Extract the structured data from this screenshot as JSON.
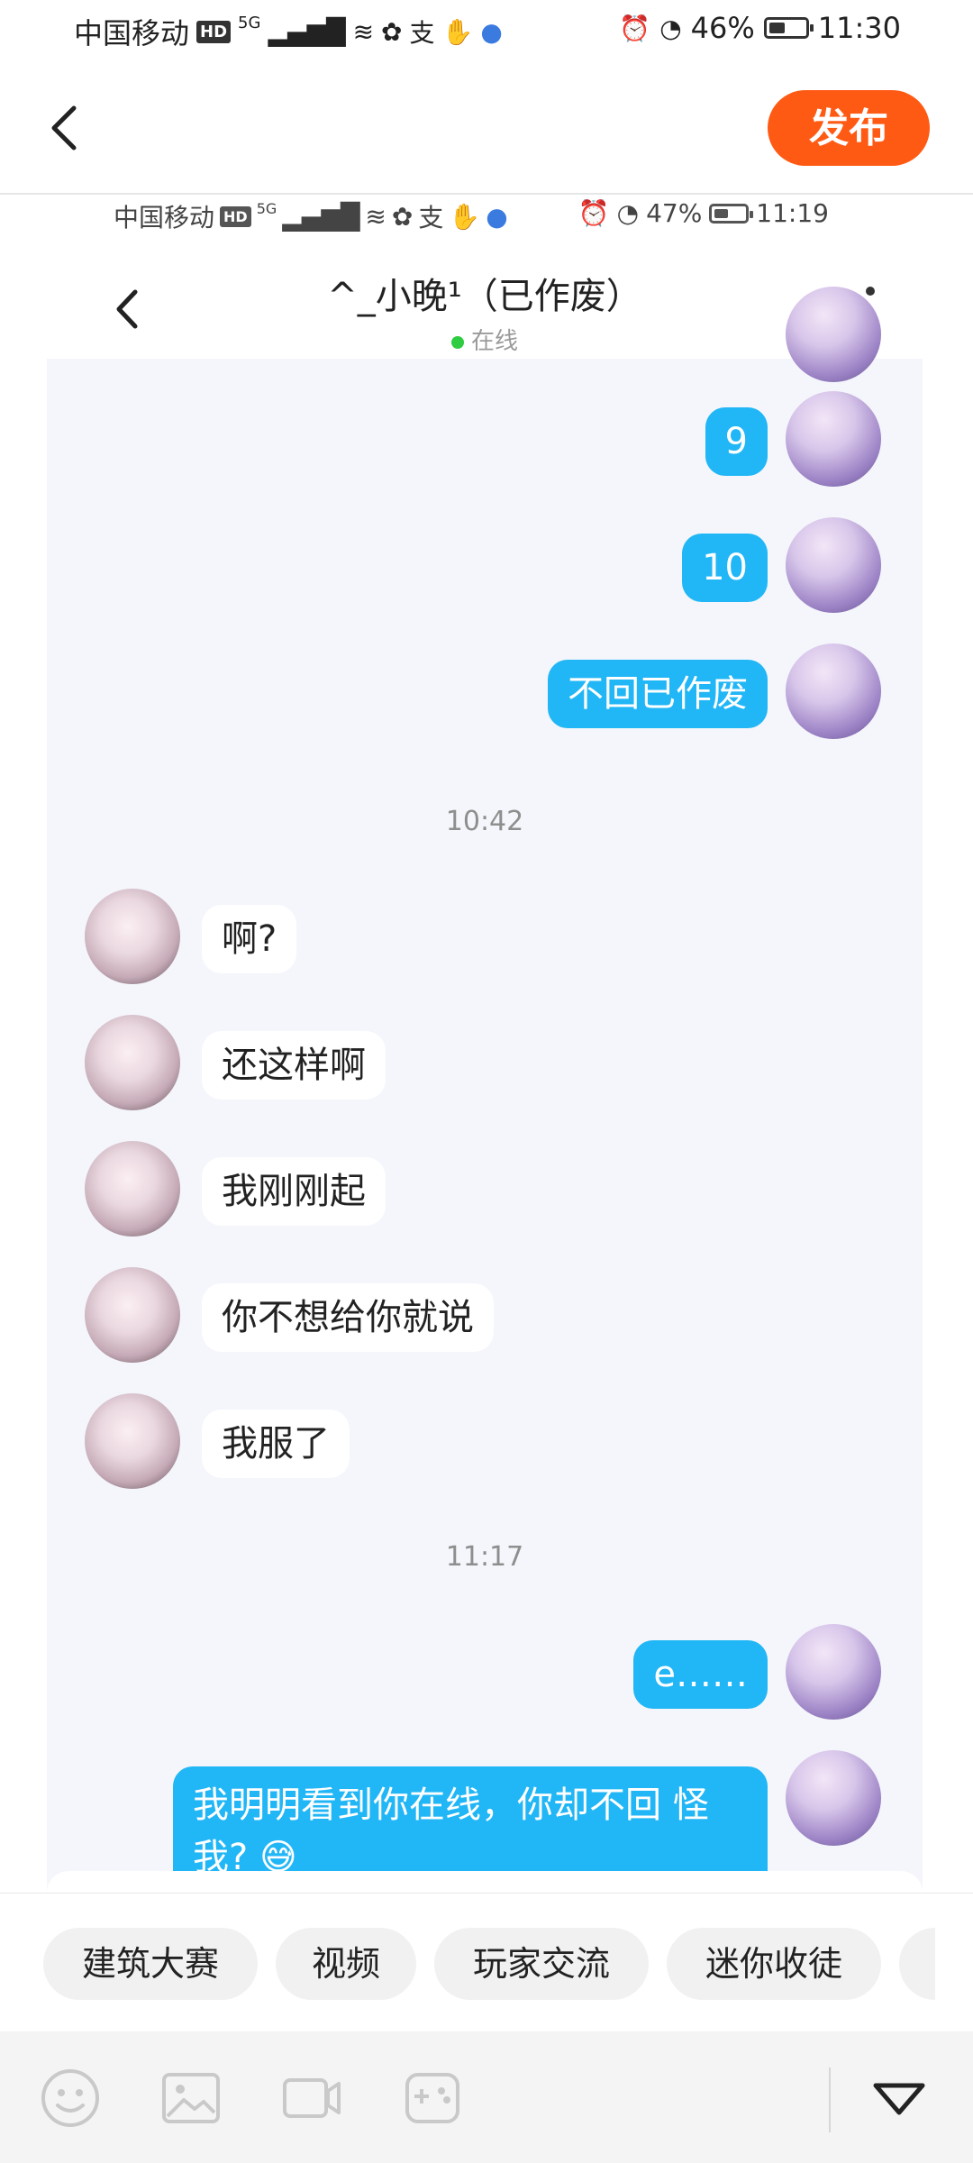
{
  "status_bar": {
    "carrier": "中国移动",
    "hd": "HD",
    "signal": "5G",
    "battery": "46%",
    "battery_level": 0.46,
    "time": "11:30"
  },
  "top_bar": {
    "publish_label": "发布"
  },
  "screenshot": {
    "status_bar": {
      "carrier": "中国移动",
      "hd": "HD",
      "signal": "5G",
      "battery": "47%",
      "battery_level": 0.47,
      "time": "11:19"
    },
    "chat": {
      "title": "^_小晚¹（已作废）",
      "presence": "在线",
      "messages": [
        {
          "from": "me",
          "text": "9"
        },
        {
          "from": "me",
          "text": "10"
        },
        {
          "from": "me",
          "text": "不回已作废"
        },
        {
          "timestamp": "10:42"
        },
        {
          "from": "her",
          "text": "啊?"
        },
        {
          "from": "her",
          "text": "还这样啊"
        },
        {
          "from": "her",
          "text": "我刚刚起"
        },
        {
          "from": "her",
          "text": "你不想给你就说"
        },
        {
          "from": "her",
          "text": "我服了"
        },
        {
          "timestamp": "11:17"
        },
        {
          "from": "me",
          "text": "e……"
        },
        {
          "from": "me",
          "text": "我明明看到你在线，你却不回 怪我? 😅"
        }
      ]
    }
  },
  "tags": [
    "建筑大赛",
    "视频",
    "玩家交流",
    "迷你收徒"
  ],
  "toolbar": {
    "icons": [
      "emoji-icon",
      "image-icon",
      "video-icon",
      "gamepad-icon",
      "collapse-icon"
    ]
  },
  "colors": {
    "accent": "#ff5a14",
    "my_bubble": "#21b6f6",
    "her_bubble": "#ffffff",
    "chat_bg": "#f4f6fb",
    "online_dot": "#2ecc40"
  }
}
